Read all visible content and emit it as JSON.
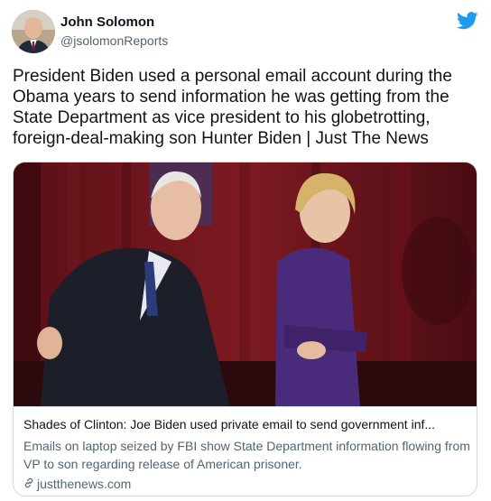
{
  "tweet": {
    "author": {
      "name": "John Solomon",
      "handle": "@jsolomonReports"
    },
    "text": "President Biden used a personal email account during the Obama years to send information he was getting from the State Department as vice president to his globetrotting, foreign-deal-making son Hunter Biden | Just The News",
    "card": {
      "title": "Shades of Clinton: Joe Biden used private email to send government inf...",
      "description": "Emails on laptop seized by FBI show State Department information flowing from VP to son regarding release of American prisoner.",
      "domain": "justthenews.com",
      "image_icon": "photo-of-two-people-laughing"
    },
    "icons": {
      "brand": "twitter-bird-icon",
      "link": "link-icon"
    },
    "colors": {
      "brand": "#1d9bf0",
      "text": "#0f1419",
      "secondary": "#536471",
      "border": "#cfd9de"
    }
  }
}
